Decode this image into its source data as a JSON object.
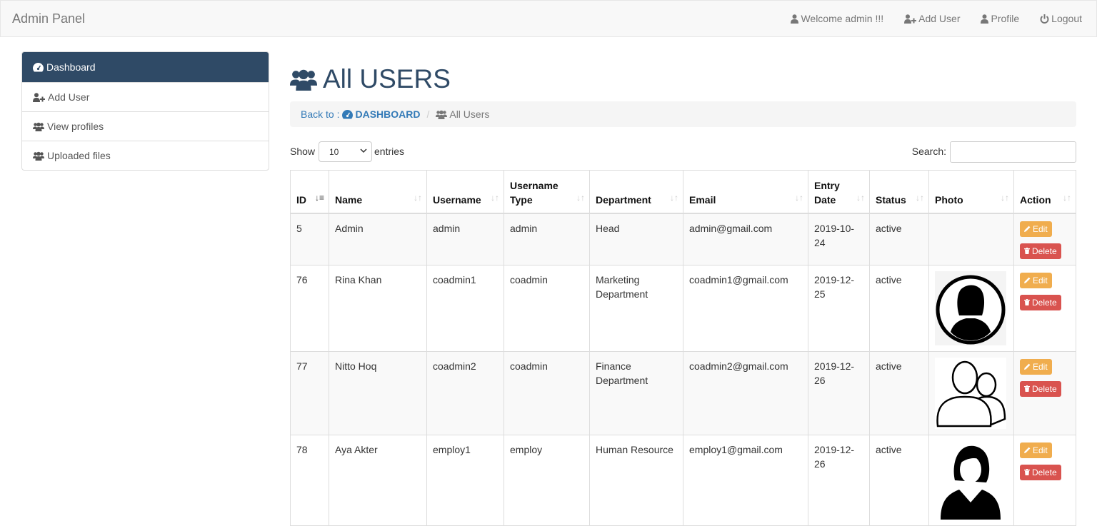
{
  "navbar": {
    "brand": "Admin Panel",
    "welcome": "Welcome admin !!!",
    "add_user": "Add User",
    "profile": "Profile",
    "logout": "Logout"
  },
  "sidebar": {
    "items": [
      {
        "label": "Dashboard",
        "icon": "dashboard-icon"
      },
      {
        "label": "Add User",
        "icon": "user-plus-icon"
      },
      {
        "label": "View profiles",
        "icon": "users-icon"
      },
      {
        "label": "Uploaded files",
        "icon": "users-icon"
      }
    ]
  },
  "main": {
    "title": "All USERS",
    "breadcrumb": {
      "prefix": "Back to :",
      "link": "DASHBOARD",
      "current": "All Users"
    },
    "show_label": "Show",
    "entries_value": "10",
    "entries_label": "entries",
    "search_label": "Search:",
    "search_value": ""
  },
  "table": {
    "headers": [
      "ID",
      "Name",
      "Username",
      "Username Type",
      "Department",
      "Email",
      "Entry Date",
      "Status",
      "Photo",
      "Action"
    ],
    "edit_label": "Edit",
    "delete_label": "Delete",
    "rows": [
      {
        "id": "5",
        "name": "Admin",
        "username": "admin",
        "type": "admin",
        "department": "Head",
        "email": "admin@gmail.com",
        "date": "2019-10-24",
        "status": "active",
        "photo": "none"
      },
      {
        "id": "76",
        "name": "Rina Khan",
        "username": "coadmin1",
        "type": "coadmin",
        "department": "Marketing Department",
        "email": "coadmin1@gmail.com",
        "date": "2019-12-25",
        "status": "active",
        "photo": "female-avatar-circle"
      },
      {
        "id": "77",
        "name": "Nitto Hoq",
        "username": "coadmin2",
        "type": "coadmin",
        "department": "Finance Department",
        "email": "coadmin2@gmail.com",
        "date": "2019-12-26",
        "status": "active",
        "photo": "two-users-outline"
      },
      {
        "id": "78",
        "name": "Aya Akter",
        "username": "employ1",
        "type": "employ",
        "department": "Human Resource",
        "email": "employ1@gmail.com",
        "date": "2019-12-26",
        "status": "active",
        "photo": "female-avatar-silhouette"
      }
    ]
  }
}
